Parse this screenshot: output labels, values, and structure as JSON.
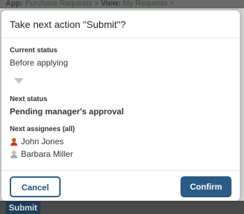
{
  "background": {
    "breadcrumb": {
      "app_prefix": "App:",
      "app_name": "Purchase Requests",
      "separator": ">",
      "view_prefix": "View:",
      "view_name": "My Requests",
      "trailing": ">"
    },
    "submit_label": "Submit"
  },
  "dialog": {
    "title": "Take next action \"Submit\"?",
    "current_status_label": "Current status",
    "current_status_value": "Before applying",
    "next_status_label": "Next status",
    "next_status_value": "Pending manager's approval",
    "next_assignees_label": "Next assignees (all)",
    "assignees": [
      {
        "name": "John Jones",
        "avatar_icon": "user-avatar-icon",
        "avatar_color": "#b5651d"
      },
      {
        "name": "Barbara Miller",
        "avatar_icon": "user-avatar-icon",
        "avatar_color": "#9aa7c7"
      }
    ],
    "cancel_label": "Cancel",
    "confirm_label": "Confirm"
  },
  "colors": {
    "primary": "#2a5b85",
    "overlay": "#cfcfcf",
    "muted_arrow": "#c4c4c4"
  }
}
